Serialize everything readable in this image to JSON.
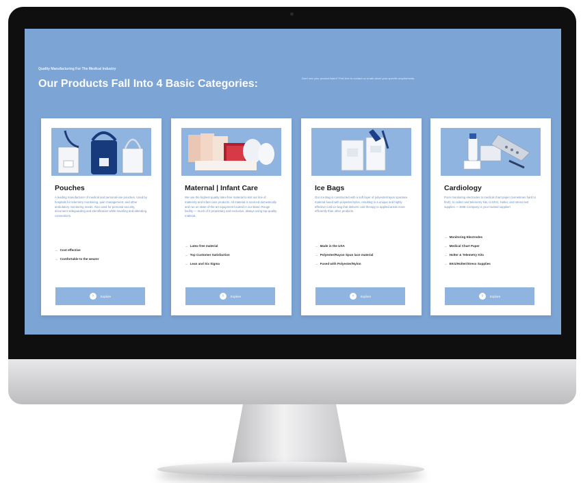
{
  "header": {
    "eyebrow": "Quality Manufacturing For The Medical Industry",
    "headline": "Our Products Fall Into 4 Basic Categories:",
    "note": "Don't see your product listed? Feel free to contact us to talk about your specific requirements."
  },
  "cards": [
    {
      "title": "Pouches",
      "description": "A leading manufacturer of medical and personal-use pouches. Used by hospitals for telemetry monitoring, pain management, and other ambulatory monitoring needs. Also used for personal security, document safeguarding and identification while traveling and attending conventions.",
      "features": [
        "Cost effective",
        "Comfortable to the wearer"
      ],
      "button": "Explore"
    },
    {
      "title": "Maternal | Infant Care",
      "description": "We use the highest quality latex-free material to knit our line of maternity and infant care products. All material is sourced domestically and run on state-of-the-art equipment located in our Baton Rouge facility — much of it proprietary and exclusive, always using top-quality material.",
      "features": [
        "Latex-free material",
        "Top Customer Satisfaction",
        "Lean and Six Sigma"
      ],
      "button": "Explore"
    },
    {
      "title": "Ice Bags",
      "description": "Our Ice Bag is constructed with a soft layer of polyester/rayon spunlace material fused with polyester/nylon, resulting in a unique and highly effective cold ice bag that delivers cold therapy to applied areas more efficiently than other products.",
      "features": [
        "Made in the USA",
        "Polyester/Rayon Spun lace material",
        "Fused with Polyester/Nylon"
      ],
      "button": "Explore"
    },
    {
      "title": "Cardiology",
      "description": "From monitoring electrodes to medical chart paper (sometimes hard to find!), to Holter and telemetry kits, to EKG, Holter, and stress test supplies — EME Company is your trusted supplier!",
      "features": [
        "Monitoring Electrodes",
        "Medical Chart Paper",
        "Holter & Telemetry Kits",
        "EKG/Holter/Stress Supplies"
      ],
      "button": "Explore"
    }
  ],
  "colors": {
    "screen_bg": "#7ca4d5",
    "card_image_bg": "#8fb4df",
    "button_bg": "#8fb4df",
    "arrow": "#4c7fc0"
  },
  "icons": {
    "feature_bullet": "arrow-right-icon",
    "button": "chevron-right-circle-icon"
  }
}
